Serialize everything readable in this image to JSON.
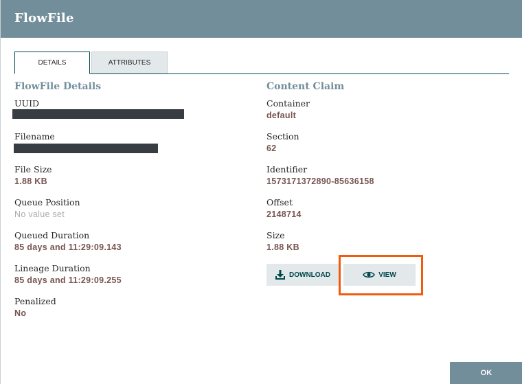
{
  "header": {
    "title": "FlowFile"
  },
  "tabs": [
    {
      "label": "DETAILS"
    },
    {
      "label": "ATTRIBUTES"
    }
  ],
  "flowfile_details": {
    "title": "FlowFile Details",
    "uuid": {
      "label": "UUID"
    },
    "filename": {
      "label": "Filename"
    },
    "file_size": {
      "label": "File Size",
      "value": "1.88 KB"
    },
    "queue_position": {
      "label": "Queue Position",
      "value": "No value set"
    },
    "queued_duration": {
      "label": "Queued Duration",
      "value": "85 days and 11:29:09.143"
    },
    "lineage_duration": {
      "label": "Lineage Duration",
      "value": "85 days and 11:29:09.255"
    },
    "penalized": {
      "label": "Penalized",
      "value": "No"
    }
  },
  "content_claim": {
    "title": "Content Claim",
    "container": {
      "label": "Container",
      "value": "default"
    },
    "section": {
      "label": "Section",
      "value": "62"
    },
    "identifier": {
      "label": "Identifier",
      "value": "1573171372890-85636158"
    },
    "offset": {
      "label": "Offset",
      "value": "2148714"
    },
    "size": {
      "label": "Size",
      "value": "1.88 KB"
    },
    "download_label": "DOWNLOAD",
    "view_label": "VIEW"
  },
  "footer": {
    "ok_label": "OK"
  },
  "colors": {
    "header_bg": "#728e9b",
    "value_text": "#775351",
    "highlight": "#f25a0e",
    "button_text": "#004849"
  },
  "icons": {
    "download": "download-icon",
    "view": "eye-icon"
  }
}
